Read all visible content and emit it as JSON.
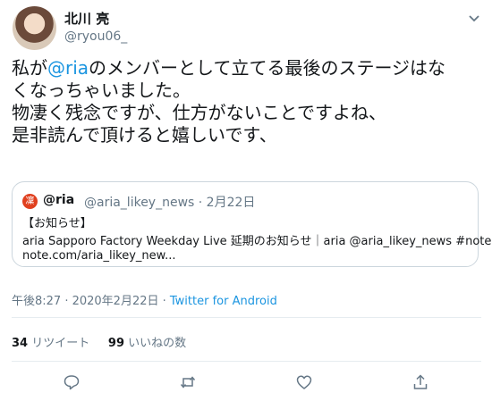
{
  "user": {
    "name": "北川 亮",
    "handle": "@ryou06_"
  },
  "tweet": {
    "lines": [
      {
        "pre": "私が",
        "mention": "@ria",
        "post": "のメンバーとして立てる最後のステージはな"
      },
      "くなっちゃいました。",
      "物凄く残念ですが、仕方がないことですよね、",
      "是非読んで頂けると嬉しいです、"
    ]
  },
  "quote": {
    "avatar_glyph": "凜",
    "name": "@ria",
    "meta": "@aria_likey_news · 2月22日",
    "line1": "【お知らせ】",
    "line2": "aria Sapporo Factory Weekday Live 延期のお知らせ｜aria @aria_likey_news #note",
    "line3": "note.com/aria_likey_new..."
  },
  "meta": {
    "time": "午後8:27 · 2020年2月22日 · ",
    "source": "Twitter for Android"
  },
  "stats": {
    "retweets_count": "34",
    "retweets_label": "リツイート",
    "likes_count": "99",
    "likes_label": "いいねの数"
  },
  "icons": [
    "chevron-down-icon",
    "reply-icon",
    "retweet-icon",
    "like-icon",
    "share-icon"
  ],
  "colors": {
    "link": "#1b95e0",
    "secondary": "#657786",
    "border": "#ccd6dd"
  }
}
